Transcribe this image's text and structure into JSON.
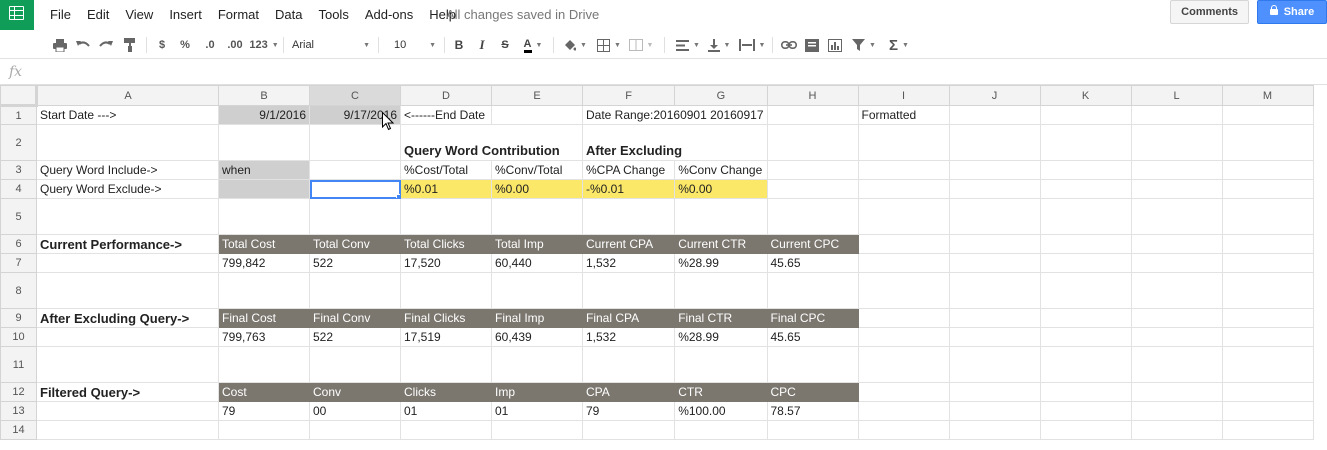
{
  "menu": {
    "items": [
      "File",
      "Edit",
      "View",
      "Insert",
      "Format",
      "Data",
      "Tools",
      "Add-ons",
      "Help"
    ],
    "status": "All changes saved in Drive",
    "comments_label": "Comments",
    "share_label": "Share"
  },
  "toolbar": {
    "currency": "$",
    "percent": "%",
    "dec_decrease": ".0",
    "dec_increase": ".00",
    "more_formats": "123",
    "font": "Arial",
    "font_size": "10",
    "bold": "B",
    "italic": "I",
    "strike": "S",
    "text_color": "A",
    "sum": "Σ"
  },
  "formula_bar": {
    "fx": "fx",
    "value": ""
  },
  "columns": [
    "A",
    "B",
    "C",
    "D",
    "E",
    "F",
    "G",
    "H",
    "I",
    "J",
    "K",
    "L",
    "M"
  ],
  "rows": {
    "r1": {
      "num": "1",
      "a": "Start Date --->",
      "b": "9/1/2016",
      "c": "9/17/2016",
      "d": "<------End Date",
      "f": "Date Range:20160901 20160917",
      "i": "Formatted"
    },
    "r2": {
      "num": "2",
      "d": "Query Word Contribution",
      "f": "After Excluding"
    },
    "r3": {
      "num": "3",
      "a": "Query Word Include->",
      "b": "when",
      "d": "%Cost/Total",
      "e": "%Conv/Total",
      "f": "%CPA Change",
      "g": "%Conv Change"
    },
    "r4": {
      "num": "4",
      "a": "Query Word Exclude->",
      "b": "",
      "c": "",
      "d": "%0.01",
      "e": "%0.00",
      "f": "-%0.01",
      "g": "%0.00"
    },
    "r5": {
      "num": "5"
    },
    "r6": {
      "num": "6",
      "a": "Current Performance->",
      "b": "Total Cost",
      "c": "Total Conv",
      "d": "Total Clicks",
      "e": "Total Imp",
      "f": "Current CPA",
      "g": "Current CTR",
      "h": "Current CPC"
    },
    "r7": {
      "num": "7",
      "b": "799,842",
      "c": "522",
      "d": "17,520",
      "e": "60,440",
      "f": "1,532",
      "g": "%28.99",
      "h": "45.65"
    },
    "r8": {
      "num": "8"
    },
    "r9": {
      "num": "9",
      "a": "After Excluding Query->",
      "b": "Final Cost",
      "c": "Final Conv",
      "d": "Final Clicks",
      "e": "Final Imp",
      "f": "Final CPA",
      "g": "Final CTR",
      "h": "Final CPC"
    },
    "r10": {
      "num": "10",
      "b": "799,763",
      "c": "522",
      "d": "17,519",
      "e": "60,439",
      "f": "1,532",
      "g": "%28.99",
      "h": "45.65"
    },
    "r11": {
      "num": "11"
    },
    "r12": {
      "num": "12",
      "a": "Filtered Query->",
      "b": "Cost",
      "c": "Conv",
      "d": "Clicks",
      "e": "Imp",
      "f": "CPA",
      "g": "CTR",
      "h": "CPC"
    },
    "r13": {
      "num": "13",
      "b": "79",
      "c": "00",
      "d": "01",
      "e": "01",
      "f": "79",
      "g": "%100.00",
      "h": "78.57"
    },
    "r14": {
      "num": "14"
    }
  },
  "colors": {
    "brand_green": "#0f9d58",
    "share_blue": "#4d90fe",
    "header_dark": "#7b776f",
    "highlight_yellow": "#fce868",
    "input_gray": "#cfcfcf",
    "selection_blue": "#4285f4"
  }
}
